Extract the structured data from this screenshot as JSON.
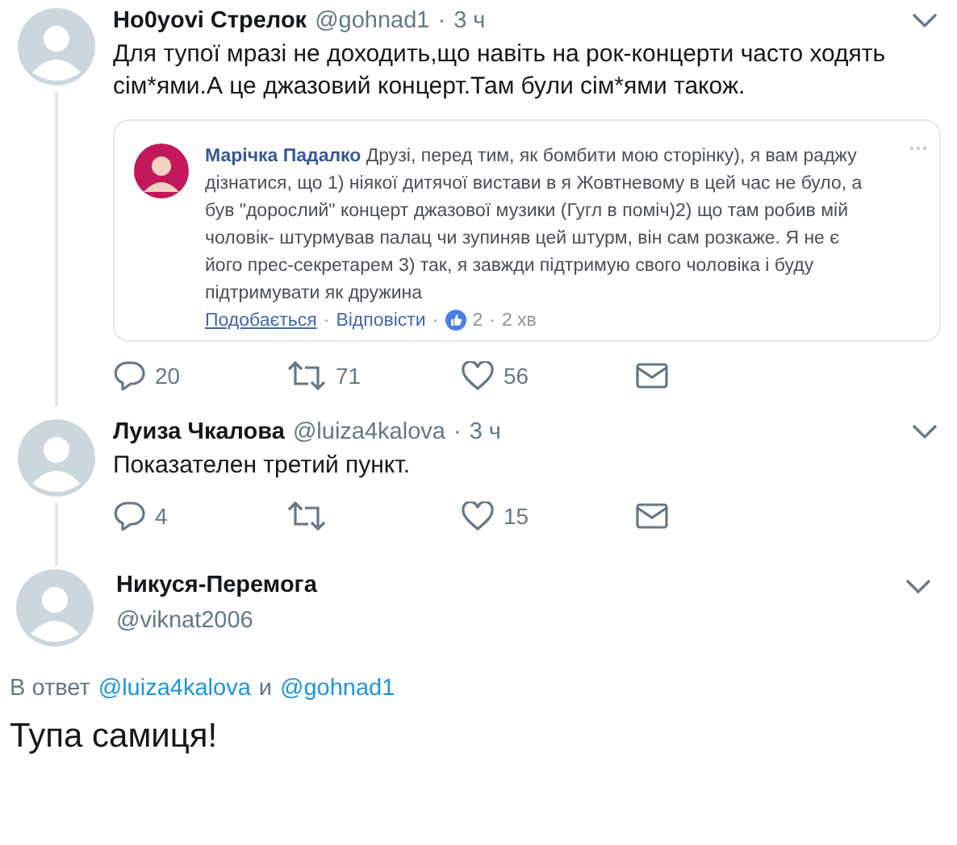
{
  "tweets": [
    {
      "name": "Ho0yovi Стрелок",
      "handle": "@gohnad1",
      "separator": "·",
      "time": "3 ч",
      "text": "Для тупої мразі не доходить,що навіть на рок-концерти часто ходять сім*ями.А це джазовий концерт.Там були сім*ями також.",
      "embed": {
        "author": "Марічка Падалко",
        "text": "Друзі, перед тим, як бомбити мою сторінку), я вам раджу дізнатися, що 1) ніякої дитячої вистави в я Жовтневому в цей час не було, а був \"дорослий\" концерт джазової музики (Гугл в поміч)2) що там робив мій чоловік- штурмував палац чи зупиняв цей штурм, він сам розкаже. Я не є його прес-секретарем 3) так, я завжди підтримую свого чоловіка і буду підтримувати як дружина",
        "separator": "·",
        "like_link": "Подобається",
        "reply_link": "Відповісти",
        "reactions": "2",
        "age": "2 хв"
      },
      "actions": [
        {
          "kind": "reply",
          "count": "20"
        },
        {
          "kind": "retweet",
          "count": "71"
        },
        {
          "kind": "like",
          "count": "56"
        },
        {
          "kind": "message"
        }
      ]
    },
    {
      "name": "Луиза Чкалова",
      "handle": "@luiza4kalova",
      "separator": "·",
      "time": "3 ч",
      "text": "Показателен третий пункт.",
      "actions": [
        {
          "kind": "reply",
          "count": "4"
        },
        {
          "kind": "retweet"
        },
        {
          "kind": "like",
          "count": "15"
        },
        {
          "kind": "message"
        }
      ]
    }
  ],
  "focus": {
    "name": "Никуся-Перемога",
    "handle": "@viknat2006",
    "reply_prefix": "В ответ",
    "reply_handles": [
      "@luiza4kalova",
      "@gohnad1"
    ],
    "reply_joiner": "и",
    "text": "Тупа самиця!"
  }
}
